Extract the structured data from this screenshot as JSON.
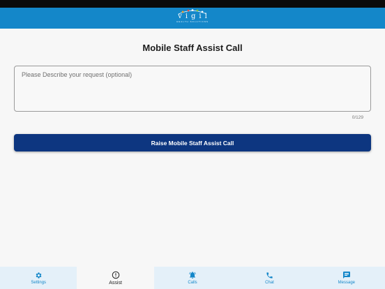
{
  "header": {
    "logo_text": "vigil",
    "logo_subtitle": "HEALTH SOLUTIONS",
    "colors": {
      "background": "#1487c9"
    }
  },
  "page": {
    "title": "Mobile Staff Assist Call"
  },
  "request": {
    "value": "",
    "placeholder": "Please Describe your request (optional)",
    "counter": "0/129"
  },
  "action": {
    "label": "Raise Mobile Staff Assist Call",
    "color": "#0d3680"
  },
  "tabs": [
    {
      "label": "Settings",
      "icon": "gear-icon",
      "active": false
    },
    {
      "label": "Assist",
      "icon": "alert-circle-icon",
      "active": true
    },
    {
      "label": "Calls",
      "icon": "bell-ringing-icon",
      "active": false
    },
    {
      "label": "Chat",
      "icon": "phone-icon",
      "active": false
    },
    {
      "label": "Message",
      "icon": "message-icon",
      "active": false
    }
  ]
}
